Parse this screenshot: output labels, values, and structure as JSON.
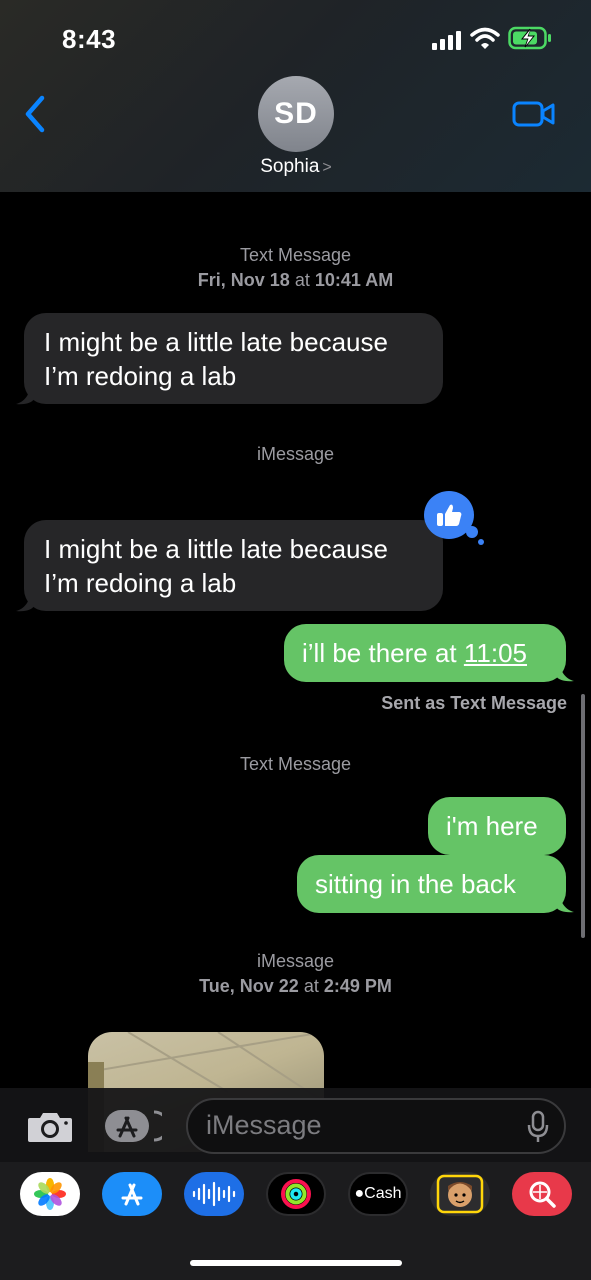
{
  "status_bar": {
    "time": "8:43"
  },
  "header": {
    "avatar_initials": "SD",
    "contact_name": "Sophia",
    "contact_chevron": ">"
  },
  "messages": {
    "meta1_service": "Text Message",
    "meta1_date": "Fri, Nov 18",
    "meta1_at": "at",
    "meta1_time": "10:41 AM",
    "bubble1_line1": "I might be a little late because",
    "bubble1_line2": "I’m redoing a lab",
    "meta2_service": "iMessage",
    "bubble2_line1": "I might be a little late because",
    "bubble2_line2": "I’m redoing a lab",
    "out1_prefix": "i’ll be there at ",
    "out1_time": "11:05",
    "sent_note": "Sent as Text Message",
    "meta3_service": "Text Message",
    "out2": "i'm here",
    "out3": "sitting in the back",
    "meta4_service": "iMessage",
    "meta4_date": "Tue, Nov 22",
    "meta4_at": "at",
    "meta4_time": "2:49 PM"
  },
  "composer": {
    "placeholder": "iMessage"
  },
  "app_drawer": {
    "cash_label": "Cash"
  },
  "colors": {
    "incoming": "#262628",
    "outgoing": "#65c466",
    "accent": "#3b82f6",
    "meta": "#9b9ba1"
  },
  "icons": [
    "back-chevron-icon",
    "video-camera-icon",
    "camera-icon",
    "app-store-icon",
    "microphone-icon",
    "photos-icon",
    "audio-message-icon",
    "fitness-icon",
    "memoji-icon",
    "search-images-icon",
    "thumbs-up-icon"
  ]
}
